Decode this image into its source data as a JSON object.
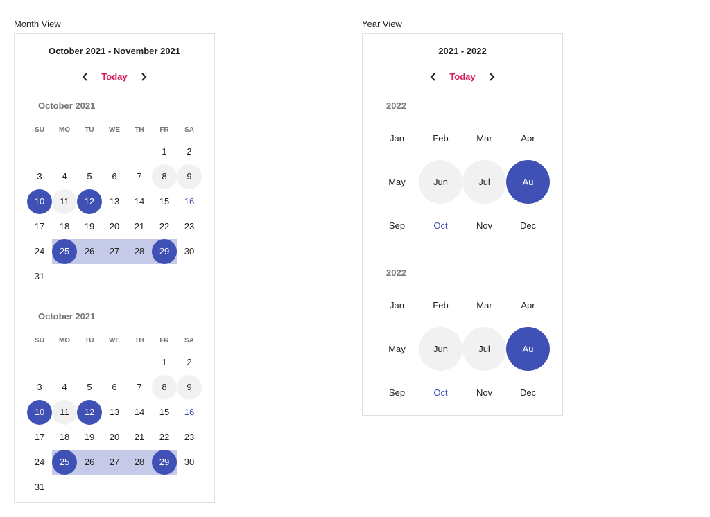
{
  "colors": {
    "accent": "#3f51b5",
    "today_link": "#d81b60",
    "range_band": "#c5cae9",
    "hover_bg": "#f1f1f1",
    "muted_text": "#757575"
  },
  "month_view": {
    "section_label": "Month View",
    "range_title": "October 2021 - November 2021",
    "today_label": "Today",
    "prev_icon": "chevron-left-icon",
    "next_icon": "chevron-right-icon",
    "weekdays": [
      "SU",
      "MO",
      "TU",
      "WE",
      "TH",
      "FR",
      "SA"
    ],
    "months": [
      {
        "label": "October 2021",
        "first_weekday": 5,
        "days_in_month": 31,
        "today": 16,
        "hover_days": [
          8,
          9,
          11
        ],
        "selected_days": [
          10,
          12,
          25,
          29
        ],
        "range_band_days": [
          25,
          26,
          27,
          28,
          29
        ]
      },
      {
        "label": "October 2021",
        "first_weekday": 5,
        "days_in_month": 31,
        "today": 16,
        "hover_days": [
          8,
          9,
          11
        ],
        "selected_days": [
          10,
          12,
          25,
          29
        ],
        "range_band_days": [
          25,
          26,
          27,
          28,
          29
        ]
      }
    ]
  },
  "year_view": {
    "section_label": "Year View",
    "range_title": "2021 - 2022",
    "today_label": "Today",
    "prev_icon": "chevron-left-icon",
    "next_icon": "chevron-right-icon",
    "years": [
      {
        "label": "2022",
        "months": [
          "Jan",
          "Feb",
          "Mar",
          "Apr",
          "May",
          "Jun",
          "Jul",
          "Au",
          "Sep",
          "Oct",
          "Nov",
          "Dec"
        ],
        "hover_indices": [
          5,
          6
        ],
        "selected_indices": [
          7
        ],
        "current_index": 9
      },
      {
        "label": "2022",
        "months": [
          "Jan",
          "Feb",
          "Mar",
          "Apr",
          "May",
          "Jun",
          "Jul",
          "Au",
          "Sep",
          "Oct",
          "Nov",
          "Dec"
        ],
        "hover_indices": [
          5,
          6
        ],
        "selected_indices": [
          7
        ],
        "current_index": 9
      }
    ]
  }
}
